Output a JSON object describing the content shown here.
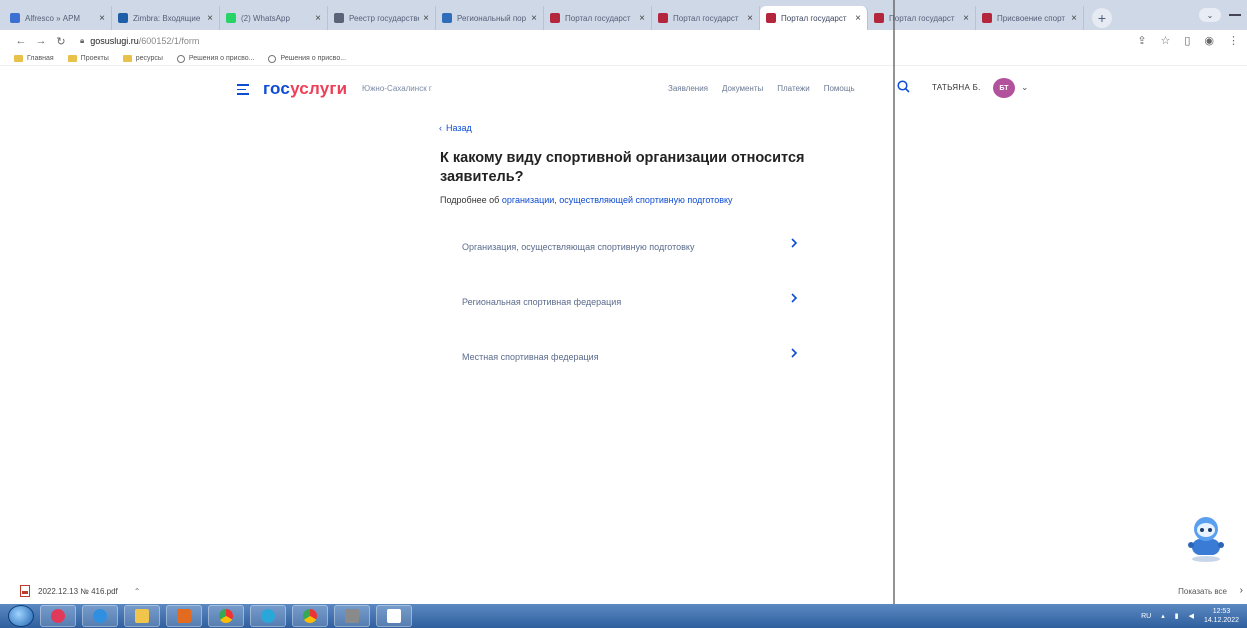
{
  "browser": {
    "tabs": [
      {
        "title": "Alfresco » АРМ",
        "favicon_color": "#3b6fd1",
        "active": false
      },
      {
        "title": "Zimbra: Входящие",
        "favicon_color": "#1f5fa8",
        "active": false
      },
      {
        "title": "(2) WhatsApp",
        "favicon_color": "#25d366",
        "active": false
      },
      {
        "title": "Реестр государстве",
        "favicon_color": "#5a6478",
        "active": false
      },
      {
        "title": "Региональный пор",
        "favicon_color": "#2f6db8",
        "active": false
      },
      {
        "title": "Портал государст",
        "favicon_color": "#b3263c",
        "active": false
      },
      {
        "title": "Портал государст",
        "favicon_color": "#b3263c",
        "active": false
      },
      {
        "title": "Портал государст",
        "favicon_color": "#b3263c",
        "active": true
      },
      {
        "title": "Портал государст",
        "favicon_color": "#b3263c",
        "active": false
      },
      {
        "title": "Присвоение спорт",
        "favicon_color": "#b3263c",
        "active": false
      }
    ],
    "tab_close_glyph": "×",
    "new_tab_glyph": "+",
    "address": {
      "host": "gosuslugi.ru",
      "path": "/600152/1/form"
    },
    "bookmarks": [
      {
        "label": "Главная",
        "icon": "folder-icon"
      },
      {
        "label": "Проекты",
        "icon": "folder-icon"
      },
      {
        "label": "ресурсы",
        "icon": "folder-icon"
      },
      {
        "label": "Решения о присво...",
        "icon": "globe-icon"
      },
      {
        "label": "Решения о присво...",
        "icon": "globe-icon"
      }
    ]
  },
  "site": {
    "logo_part1": "гос",
    "logo_part2": "услуги",
    "region": "Южно-Сахалинск г",
    "nav": [
      "Заявления",
      "Документы",
      "Платежи",
      "Помощь"
    ],
    "user_name": "ТАТЬЯНА Б.",
    "user_initials": "БТ",
    "brand_blue": "#0d4cd3",
    "brand_red": "#ee3f58"
  },
  "content": {
    "back_label": "Назад",
    "heading": "К какому виду спортивной организации относится заявитель?",
    "subtext_prefix": "Подробнее об ",
    "subtext_link": "организации, осуществляющей спортивную подготовку",
    "options": [
      {
        "label": "Организация, осуществляющая спортивную подготовку"
      },
      {
        "label": "Региональная спортивная федерация"
      },
      {
        "label": "Местная спортивная федерация"
      }
    ]
  },
  "downloads": {
    "file_name": "2022.12.13 № 416.pdf",
    "show_all": "Показать все"
  },
  "taskbar": {
    "lang": "RU",
    "time": "12:53",
    "date": "14.12.2022"
  }
}
